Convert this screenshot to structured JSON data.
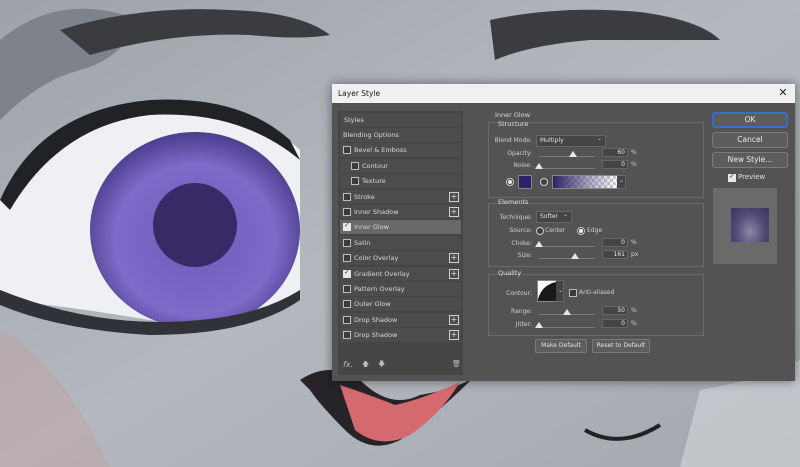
{
  "dialog": {
    "title": "Layer Style",
    "close_icon": "close-icon"
  },
  "sidebar": {
    "header": "Styles",
    "items": [
      {
        "label": "Blending Options",
        "checkbox": false,
        "checked": false,
        "plus": false,
        "indent": false,
        "active": false
      },
      {
        "label": "Bevel & Emboss",
        "checkbox": true,
        "checked": false,
        "plus": false,
        "indent": false,
        "active": false
      },
      {
        "label": "Contour",
        "checkbox": true,
        "checked": false,
        "plus": false,
        "indent": true,
        "active": false
      },
      {
        "label": "Texture",
        "checkbox": true,
        "checked": false,
        "plus": false,
        "indent": true,
        "active": false
      },
      {
        "label": "Stroke",
        "checkbox": true,
        "checked": false,
        "plus": true,
        "indent": false,
        "active": false
      },
      {
        "label": "Inner Shadow",
        "checkbox": true,
        "checked": false,
        "plus": true,
        "indent": false,
        "active": false
      },
      {
        "label": "Inner Glow",
        "checkbox": true,
        "checked": true,
        "plus": false,
        "indent": false,
        "active": true
      },
      {
        "label": "Satin",
        "checkbox": true,
        "checked": false,
        "plus": false,
        "indent": false,
        "active": false
      },
      {
        "label": "Color Overlay",
        "checkbox": true,
        "checked": false,
        "plus": true,
        "indent": false,
        "active": false
      },
      {
        "label": "Gradient Overlay",
        "checkbox": true,
        "checked": true,
        "plus": true,
        "indent": false,
        "active": false
      },
      {
        "label": "Pattern Overlay",
        "checkbox": true,
        "checked": false,
        "plus": false,
        "indent": false,
        "active": false
      },
      {
        "label": "Outer Glow",
        "checkbox": true,
        "checked": false,
        "plus": false,
        "indent": false,
        "active": false
      },
      {
        "label": "Drop Shadow",
        "checkbox": true,
        "checked": false,
        "plus": true,
        "indent": false,
        "active": false
      },
      {
        "label": "Drop Shadow",
        "checkbox": true,
        "checked": false,
        "plus": true,
        "indent": false,
        "active": false
      }
    ],
    "footer": {
      "fx": "fx.",
      "up": "🡅",
      "down": "🡇",
      "trash": "🗑"
    }
  },
  "panel": {
    "title": "Inner Glow",
    "structure": {
      "label": "Structure",
      "blend_mode_label": "Blend Mode:",
      "blend_mode_value": "Multiply",
      "opacity_label": "Opacity:",
      "opacity_value": "60",
      "opacity_fraction": 0.6,
      "noise_label": "Noise:",
      "noise_value": "0",
      "noise_fraction": 0.0,
      "unit": "%",
      "glow_color": "#2c2367"
    },
    "elements": {
      "label": "Elements",
      "technique_label": "Technique:",
      "technique_value": "Softer",
      "source_label": "Source:",
      "source_center": "Center",
      "source_edge": "Edge",
      "source_selected": "Edge",
      "choke_label": "Choke:",
      "choke_value": "0",
      "choke_fraction": 0.0,
      "size_label": "Size:",
      "size_value": "161",
      "size_fraction": 0.64,
      "pct": "%",
      "px": "px"
    },
    "quality": {
      "label": "Quality",
      "contour_label": "Contour:",
      "anti_aliased_label": "Anti-aliased",
      "range_label": "Range:",
      "range_value": "50",
      "range_fraction": 0.5,
      "jitter_label": "Jitter:",
      "jitter_value": "0",
      "jitter_fraction": 0.0,
      "unit": "%"
    },
    "buttons": {
      "make_default": "Make Default",
      "reset_default": "Reset to Default"
    }
  },
  "right": {
    "ok": "OK",
    "cancel": "Cancel",
    "new_style": "New Style...",
    "preview_label": "Preview",
    "preview_checked": true
  }
}
